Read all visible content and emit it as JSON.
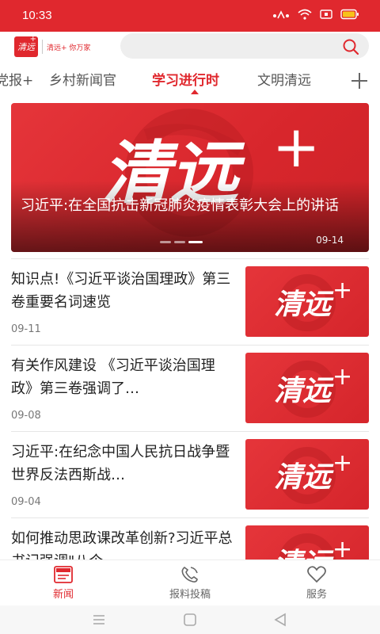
{
  "status_bar": {
    "time": "10:33"
  },
  "header": {
    "logo_mark": "清远",
    "logo_plus": "+",
    "logo_text": "清远+ 你万家"
  },
  "tabs": [
    {
      "label": "党报+",
      "active": false
    },
    {
      "label": "乡村新闻官",
      "active": false
    },
    {
      "label": "学习进行时",
      "active": true
    },
    {
      "label": "文明清远",
      "active": false
    }
  ],
  "banner": {
    "title": "习近平:在全国抗击新冠肺炎疫情表彰大会上的讲话",
    "date": "09-14",
    "brand": "清远",
    "plus": "+"
  },
  "news": [
    {
      "title": "知识点!《习近平谈治国理政》第三卷重要名词速览",
      "date": "09-11",
      "thumb": "清远",
      "plus": "+"
    },
    {
      "title": "有关作风建设 《习近平谈治国理政》第三卷强调了…",
      "date": "09-08",
      "thumb": "清远",
      "plus": "+"
    },
    {
      "title": "习近平:在纪念中国人民抗日战争暨世界反法西斯战…",
      "date": "09-04",
      "thumb": "清远",
      "plus": "+"
    },
    {
      "title": "如何推动思政课改革创新?习近平总书记强调\"八个…",
      "date": "",
      "thumb": "清远",
      "plus": "+"
    }
  ],
  "bottom_nav": [
    {
      "label": "新闻",
      "icon": "news-icon",
      "active": true
    },
    {
      "label": "报料投稿",
      "icon": "contribute-icon",
      "active": false
    },
    {
      "label": "服务",
      "icon": "heart-icon",
      "active": false
    }
  ],
  "colors": {
    "brand_red": "#e0282e"
  }
}
